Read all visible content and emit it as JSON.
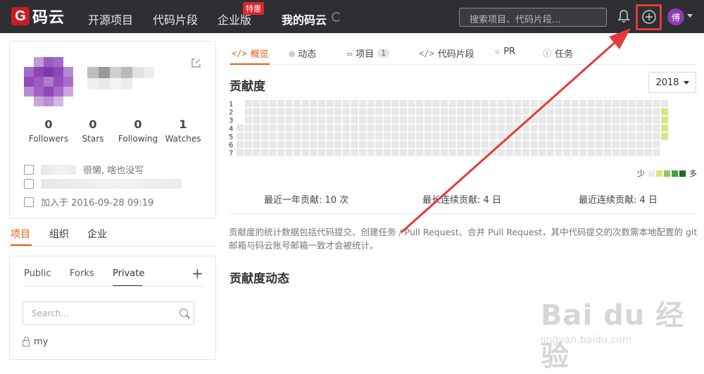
{
  "topbar": {
    "logo_mark": "G",
    "logo_text": "码云",
    "nav": [
      "开源项目",
      "代码片段",
      "企业版",
      "我的码云"
    ],
    "promo_badge": "特惠",
    "search_placeholder": "搜索项目、代码片段...",
    "avatar_char": "傅",
    "icons": [
      "bell-icon",
      "plus-circle-icon",
      "caret-down-icon"
    ],
    "highlight_color": "#e23b3b"
  },
  "profile": {
    "stats": [
      {
        "value": "0",
        "label": "Followers"
      },
      {
        "value": "0",
        "label": "Stars"
      },
      {
        "value": "0",
        "label": "Following"
      },
      {
        "value": "1",
        "label": "Watches"
      }
    ],
    "bio": "很懒, 啥也没写",
    "joined": "加入于 2016-09-28 09:19"
  },
  "side_tabs": [
    "项目",
    "组织",
    "企业"
  ],
  "projects": {
    "tabs": [
      "Public",
      "Forks",
      "Private"
    ],
    "active_tab": "Private",
    "add_icon": "+",
    "search_placeholder": "Search...",
    "items": [
      "my"
    ]
  },
  "main_tabs": [
    {
      "icon": "</>",
      "label": "概览"
    },
    {
      "icon": "◎",
      "label": "动态"
    },
    {
      "icon": "▭",
      "label": "项目",
      "badge": "1"
    },
    {
      "icon": "</>",
      "label": "代码片段"
    },
    {
      "icon": "⑂",
      "label": "PR"
    },
    {
      "icon": "ⓘ",
      "label": "任务"
    }
  ],
  "contribution": {
    "title": "贡献度",
    "year": "2018",
    "day_labels": [
      "1",
      "2",
      "3",
      "4",
      "5",
      "6",
      "7"
    ],
    "legend_less": "少",
    "legend_more": "多",
    "legend_colors": [
      "#ebebeb",
      "#d6e685",
      "#8cc665",
      "#44a340",
      "#1e6823"
    ],
    "empty_color": "#e8e8e8",
    "active_color": "#d6e685",
    "summary": [
      "最近一年贡献: 10 次",
      "最长连续贡献: 4 日",
      "最近连续贡献: 4 日"
    ],
    "note": "贡献度的统计数据包括代码提交、创建任务 / Pull Request、合并 Pull Request，其中代码提交的次数需本地配置的 git 邮箱与码云账号邮箱一致才会被统计。"
  },
  "activity_title": "贡献度动态",
  "watermark": {
    "main": "Bai du 经验",
    "sub": "jingyan.baidu.com"
  }
}
